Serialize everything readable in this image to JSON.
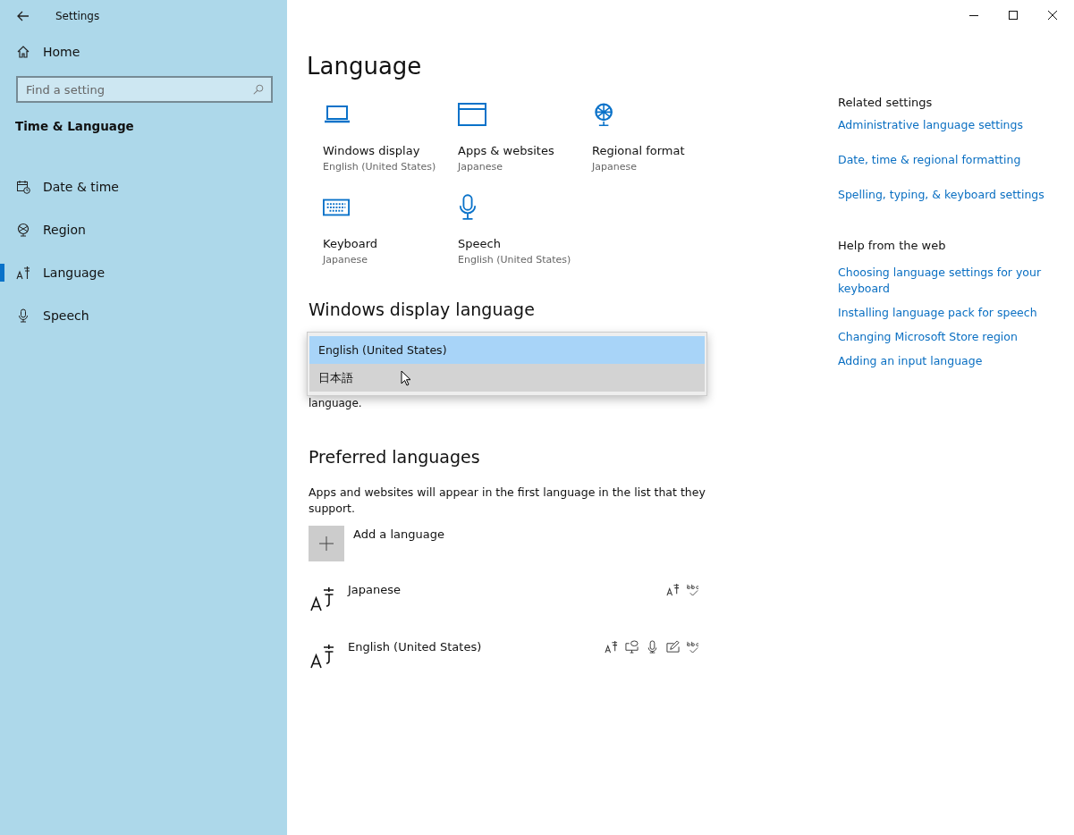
{
  "window": {
    "title": "Settings"
  },
  "sidebar": {
    "home": "Home",
    "search": {
      "placeholder": "Find a setting"
    },
    "section": "Time & Language",
    "items": [
      {
        "label": "Date & time",
        "kind": "calendar",
        "selected": false
      },
      {
        "label": "Region",
        "kind": "globe",
        "selected": false
      },
      {
        "label": "Language",
        "kind": "language",
        "selected": true
      },
      {
        "label": "Speech",
        "kind": "microphone",
        "selected": false
      }
    ]
  },
  "page": {
    "title": "Language",
    "tiles": [
      {
        "label": "Windows display",
        "value": "English (United States)",
        "kind": "laptop"
      },
      {
        "label": "Apps & websites",
        "value": "Japanese",
        "kind": "window"
      },
      {
        "label": "Regional format",
        "value": "Japanese",
        "kind": "globe"
      },
      {
        "label": "Keyboard",
        "value": "Japanese",
        "kind": "keyboard"
      },
      {
        "label": "Speech",
        "value": "English (United States)",
        "kind": "microphone"
      }
    ],
    "display_language": {
      "heading": "Windows display language",
      "dropdown_options": [
        {
          "label": "English (United States)",
          "selected": true
        },
        {
          "label": "日本語",
          "selected": false
        }
      ],
      "note_fragment": "language."
    },
    "preferred": {
      "heading": "Preferred languages",
      "description": "Apps and websites will appear in the first language in the list that they support.",
      "add_label": "Add a language",
      "languages": [
        {
          "name": "Japanese",
          "features": [
            {
              "kind": "language"
            },
            {
              "kind": "spelling"
            }
          ]
        },
        {
          "name": "English (United States)",
          "features": [
            {
              "kind": "language"
            },
            {
              "kind": "speech"
            },
            {
              "kind": "microphone"
            },
            {
              "kind": "handwriting"
            },
            {
              "kind": "spelling"
            }
          ]
        }
      ]
    }
  },
  "related": {
    "heading": "Related settings",
    "links": [
      "Administrative language settings",
      "Date, time & regional formatting",
      "Spelling, typing, & keyboard settings"
    ]
  },
  "help": {
    "heading": "Help from the web",
    "links": [
      "Choosing language settings for your keyboard",
      "Installing language pack for speech",
      "Changing Microsoft Store region",
      "Adding an input language"
    ]
  }
}
